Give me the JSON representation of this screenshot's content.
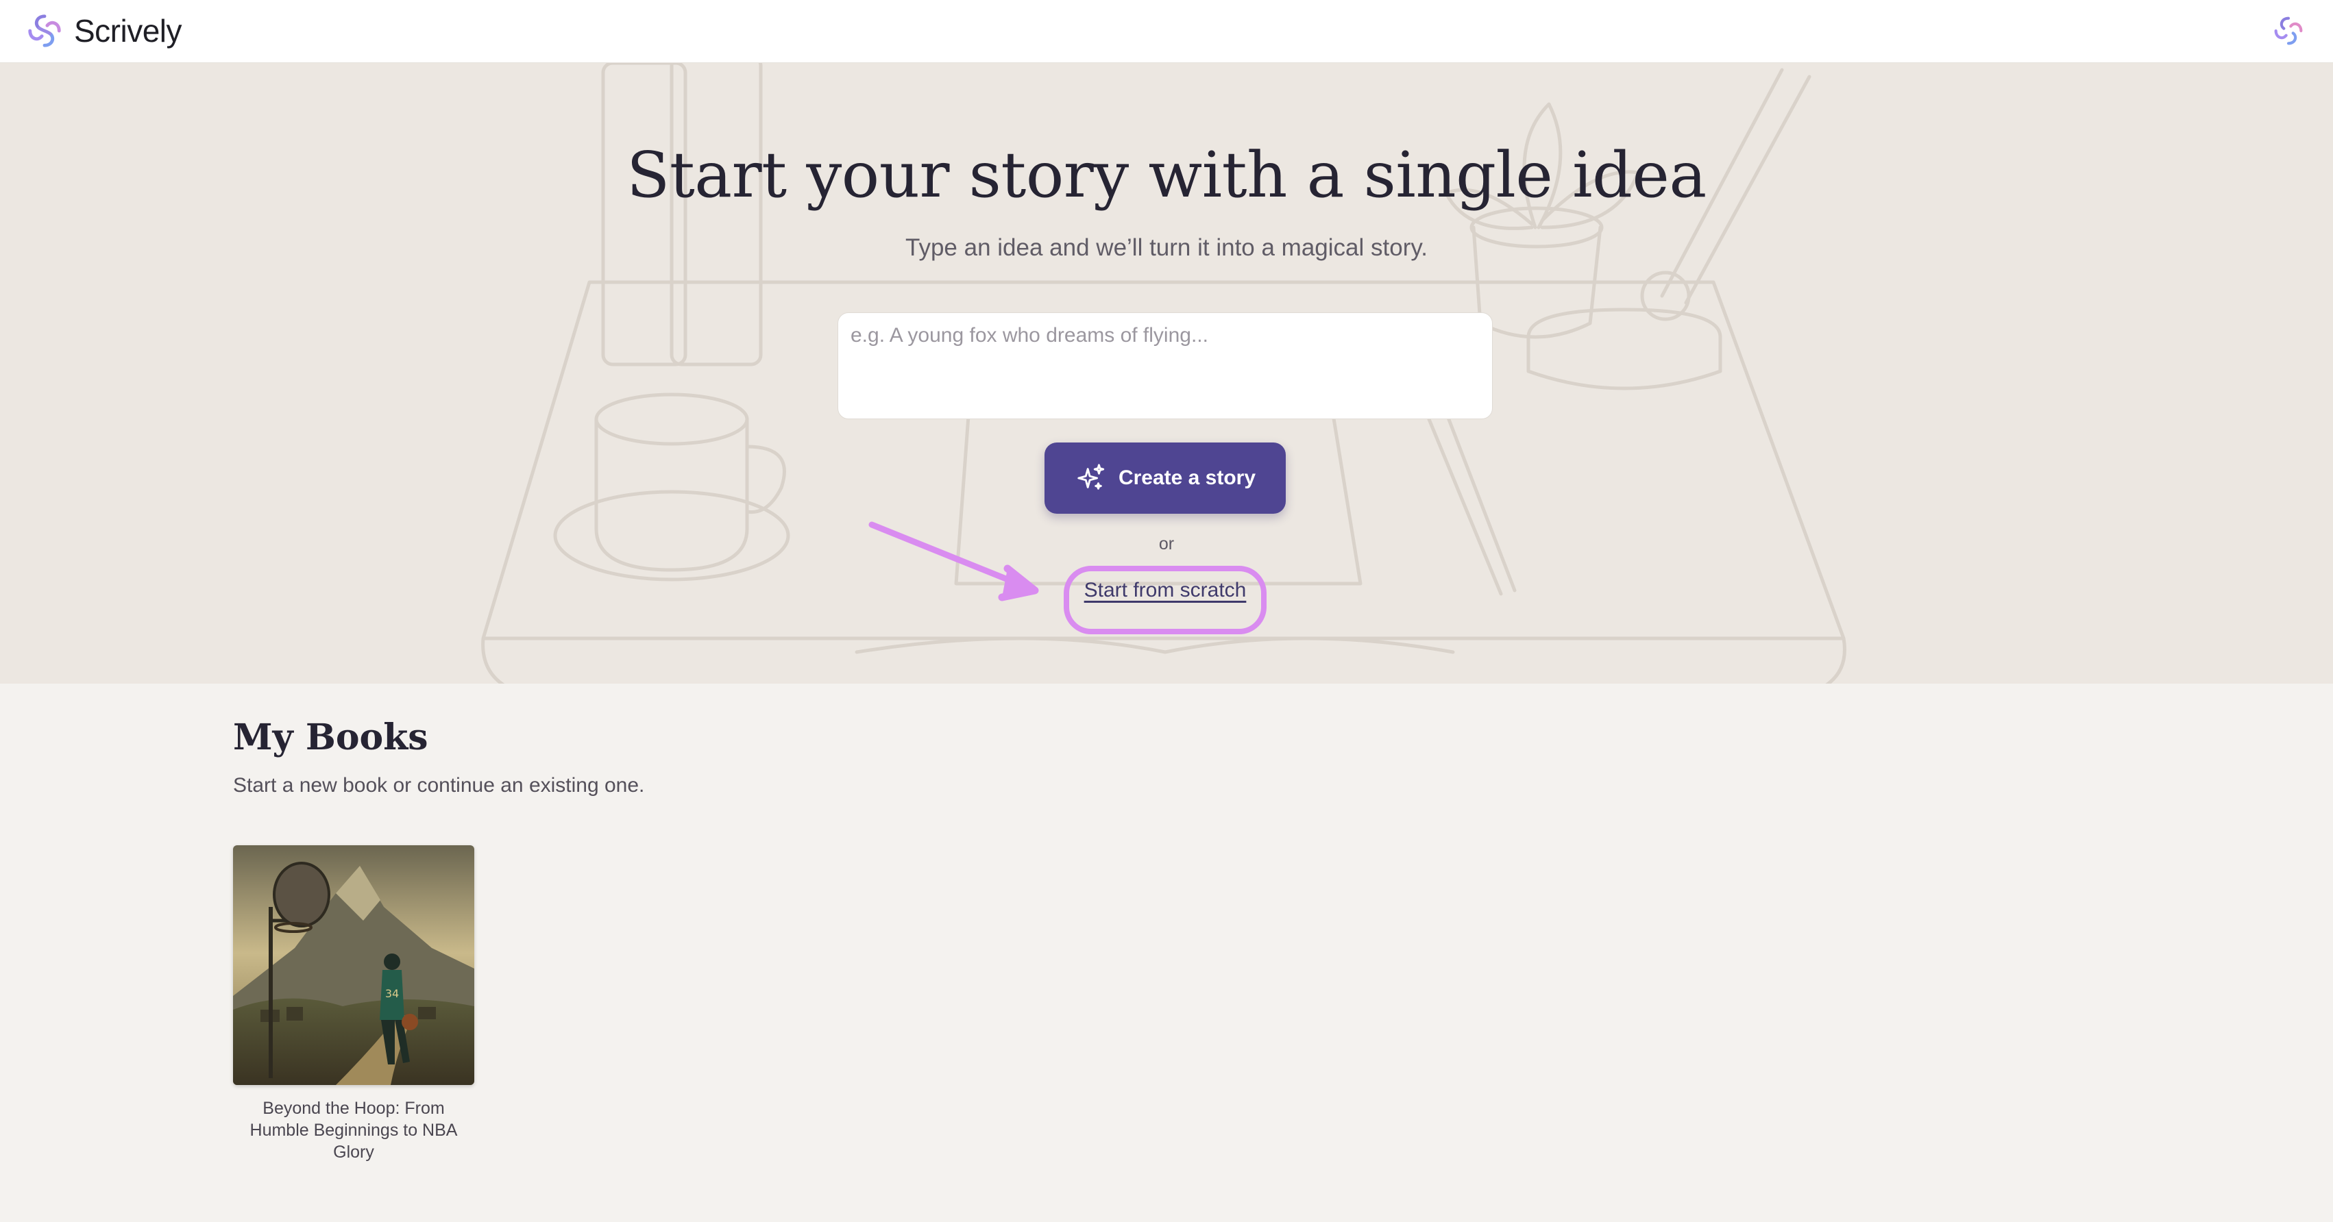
{
  "app": {
    "name": "Scrively",
    "logo_icon": "swirl-logo-icon"
  },
  "hero": {
    "title": "Start your story with a single idea",
    "subtitle": "Type an idea and we’ll turn it into a magical story.",
    "input_placeholder": "e.g. A young fox who dreams of flying...",
    "input_value": "",
    "create_button_label": "Create a story",
    "create_button_icon": "sparkle-icon",
    "or_text": "or",
    "scratch_link_label": "Start from scratch"
  },
  "books": {
    "heading": "My Books",
    "subtitle": "Start a new book or continue an existing one.",
    "items": [
      {
        "title": "Beyond the Hoop: From Humble Beginnings to NBA Glory"
      }
    ]
  },
  "colors": {
    "accent": "#4f4592",
    "annotation": "#d98cf0",
    "hero_bg": "#ece7e1",
    "page_bg": "#f4f2ef"
  }
}
